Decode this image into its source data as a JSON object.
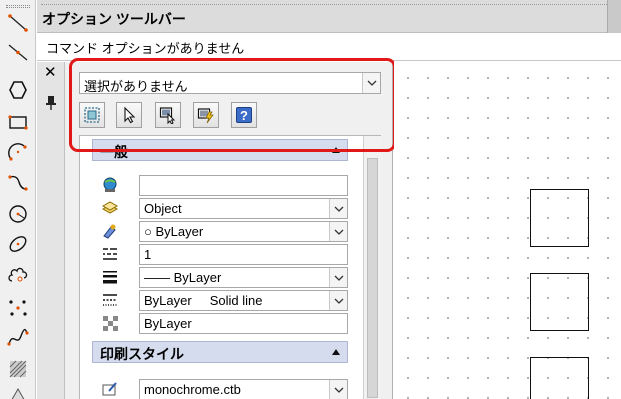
{
  "toolbar": {
    "title": "オプション ツールバー",
    "command_options": "コマンド オプションがありません",
    "tools": [
      "line-icon",
      "ray-icon",
      "polygon-icon",
      "rectangle-icon",
      "arc-icon",
      "spline-icon",
      "circle-icon",
      "ellipse-icon",
      "cloud-icon",
      "point-icon",
      "spline-curve-icon",
      "hatch-icon",
      "triangle-icon"
    ]
  },
  "properties": {
    "selection": "選択がありません",
    "buttons": [
      "quick-select-icon",
      "select-objects-icon",
      "pickadd-icon",
      "toggle-value-icon",
      "help-icon"
    ],
    "help_label": "?",
    "close_label": "✕",
    "sections": {
      "general": {
        "title": "一般",
        "rows": [
          {
            "icon": "color-icon",
            "value": "",
            "dropdown": false
          },
          {
            "icon": "layer-icon",
            "value": "Object",
            "dropdown": true
          },
          {
            "icon": "paint-icon",
            "value": "○ ByLayer",
            "dropdown": true
          },
          {
            "icon": "linetype-scale-icon",
            "value": "1",
            "dropdown": false
          },
          {
            "icon": "lineweight-icon",
            "value": "—— ByLayer",
            "dropdown": true
          },
          {
            "icon": "linetype-icon",
            "value": "ByLayer     Solid line",
            "dropdown": true
          },
          {
            "icon": "transparency-icon",
            "value": "ByLayer",
            "dropdown": false
          }
        ]
      },
      "plot_style": {
        "title": "印刷スタイル",
        "rows": [
          {
            "icon": "plot-style-icon",
            "value": "monochrome.ctb",
            "dropdown": true
          }
        ]
      }
    }
  },
  "colors": {
    "highlight": "#e01818",
    "section_header": "#d4dcee"
  }
}
